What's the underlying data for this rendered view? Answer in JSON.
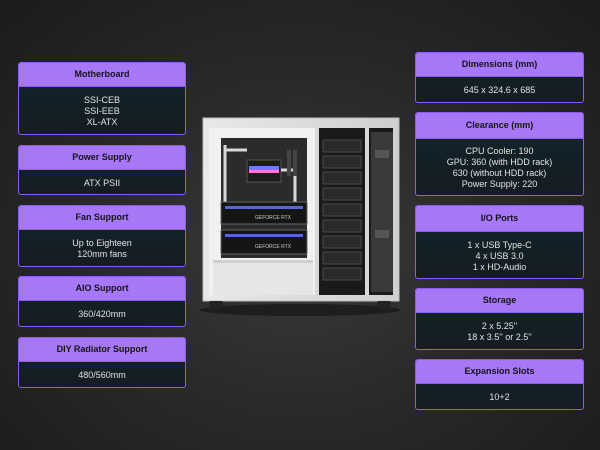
{
  "colors": {
    "accent": "#a678f7",
    "border": "#8a5cf0",
    "card_bg": "#132329"
  },
  "cards": {
    "motherboard": {
      "title": "Motherboard",
      "lines": [
        "SSI-CEB",
        "SSI-EEB",
        "XL-ATX"
      ]
    },
    "power_supply": {
      "title": "Power Supply",
      "lines": [
        "ATX PSII"
      ]
    },
    "fan_support": {
      "title": "Fan Support",
      "lines": [
        "Up to Eighteen",
        "120mm fans"
      ]
    },
    "aio_support": {
      "title": "AIO Support",
      "lines": [
        "360/420mm"
      ]
    },
    "diy_radiator": {
      "title": "DIY Radiator Support",
      "lines": [
        "480/560mm"
      ]
    },
    "dimensions": {
      "title": "Dimensions (mm)",
      "lines": [
        "645 x 324.6 x 685"
      ]
    },
    "clearance": {
      "title": "Clearance (mm)",
      "lines": [
        "CPU Cooler: 190",
        "GPU: 360 (with HDD rack)",
        "630 (without HDD rack)",
        "Power Supply: 220"
      ]
    },
    "io_ports": {
      "title": "I/O Ports",
      "lines": [
        "1 x USB Type-C",
        "4 x USB 3.0",
        "1 x HD-Audio"
      ]
    },
    "storage": {
      "title": "Storage",
      "lines": [
        "2 x 5.25''",
        "18 x 3.5'' or 2.5''"
      ]
    },
    "expansion_slots": {
      "title": "Expansion Slots",
      "lines": [
        "10+2"
      ]
    }
  },
  "case_image": {
    "gpu_label": "GEFORCE RTX"
  }
}
